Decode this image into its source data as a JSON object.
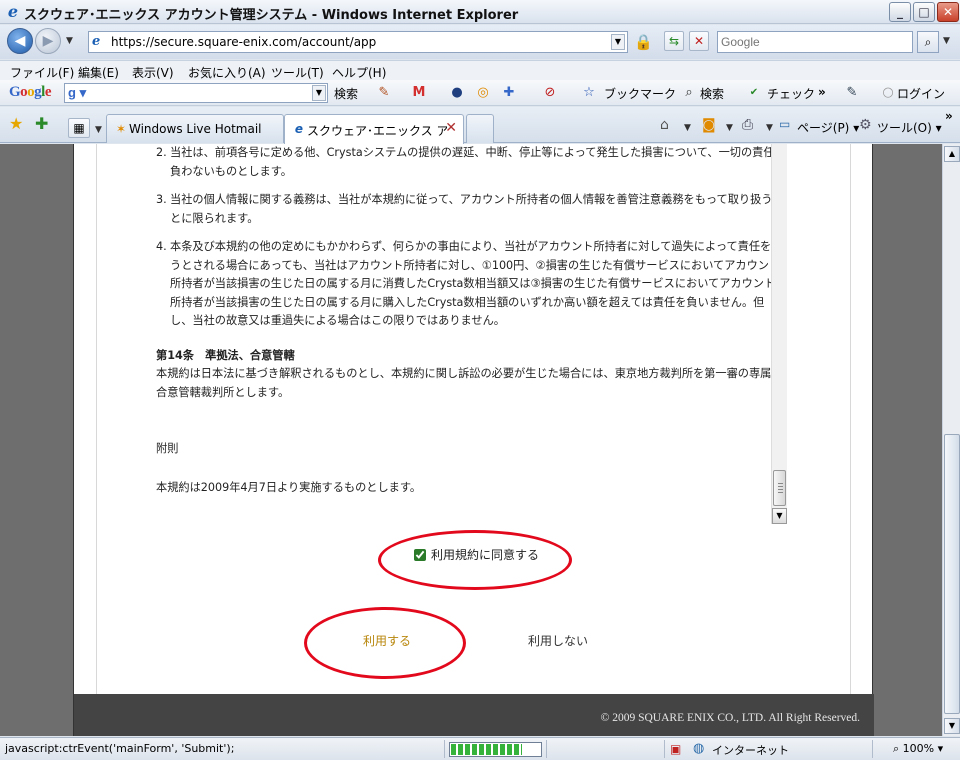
{
  "window": {
    "title": "スクウェア･エニックス アカウント管理システム - Windows Internet Explorer",
    "minimize": "_",
    "maximize": "□",
    "close": "✕"
  },
  "address": {
    "url": "https://secure.square-enix.com/account/app",
    "search_placeholder": "Google"
  },
  "menu": [
    "ファイル(F)",
    "編集(E)",
    "表示(V)",
    "お気に入り(A)",
    "ツール(T)",
    "ヘルプ(H)"
  ],
  "google_toolbar": {
    "logo": "Google",
    "g_label": "g",
    "search_label": "検索",
    "bookmarks_label": "ブックマーク",
    "search2_label": "検索",
    "check_label": "チェック",
    "login_label": "ログイン",
    "more": "»"
  },
  "tabs": [
    {
      "label": "Windows Live Hotmail",
      "active": false
    },
    {
      "label": "スクウェア･エニックス アカウ...",
      "active": true
    }
  ],
  "commands": {
    "page_label": "ページ(P)",
    "tools_label": "ツール(O)",
    "more": "»"
  },
  "terms": {
    "items": [
      {
        "num": "2.",
        "text": "当社は、前項各号に定める他、Crystaシステムの提供の遅延、中断、停止等によって発生した損害について、一切の責任を負わないものとします。"
      },
      {
        "num": "3.",
        "text": "当社の個人情報に関する義務は、当社が本規約に従って、アカウント所持者の個人情報を善管注意義務をもって取り扱うことに限られます。"
      },
      {
        "num": "4.",
        "text": "本条及び本規約の他の定めにもかかわらず、何らかの事由により、当社がアカウント所持者に対して過失によって責任を負うとされる場合にあっても、当社はアカウント所持者に対し、①100円、②損害の生じた有償サービスにおいてアカウント所持者が当該損害の生じた日の属する月に消費したCrysta数相当額又は③損害の生じた有償サービスにおいてアカウント所持者が当該損害の生じた日の属する月に購入したCrysta数相当額のいずれか高い額を超えては責任を負いません。但し、当社の故意又は重過失による場合はこの限りではありません。"
      }
    ],
    "article_title": "第14条　準拠法、合意管轄",
    "article_body": "本規約は日本法に基づき解釈されるものとし、本規約に関し訴訟の必要が生じた場合には、東京地方裁判所を第一審の専属的合意管轄裁判所とします。",
    "supplement_title": "附則",
    "supplement_body": "本規約は2009年4月7日より実施するものとします。"
  },
  "agree": {
    "label": "利用規約に同意する",
    "checked": true
  },
  "buttons": {
    "use": "利用する",
    "not_use": "利用しない"
  },
  "footer": {
    "copyright": "© 2009 SQUARE ENIX CO., LTD. All Right Reserved."
  },
  "status": {
    "text": "javascript:ctrEvent('mainForm', 'Submit');",
    "progress": 0.8,
    "zone": "インターネット",
    "zoom": "100%"
  },
  "colors": {
    "annotation_ring": "#e3091d",
    "use_link": "#b8860b"
  }
}
